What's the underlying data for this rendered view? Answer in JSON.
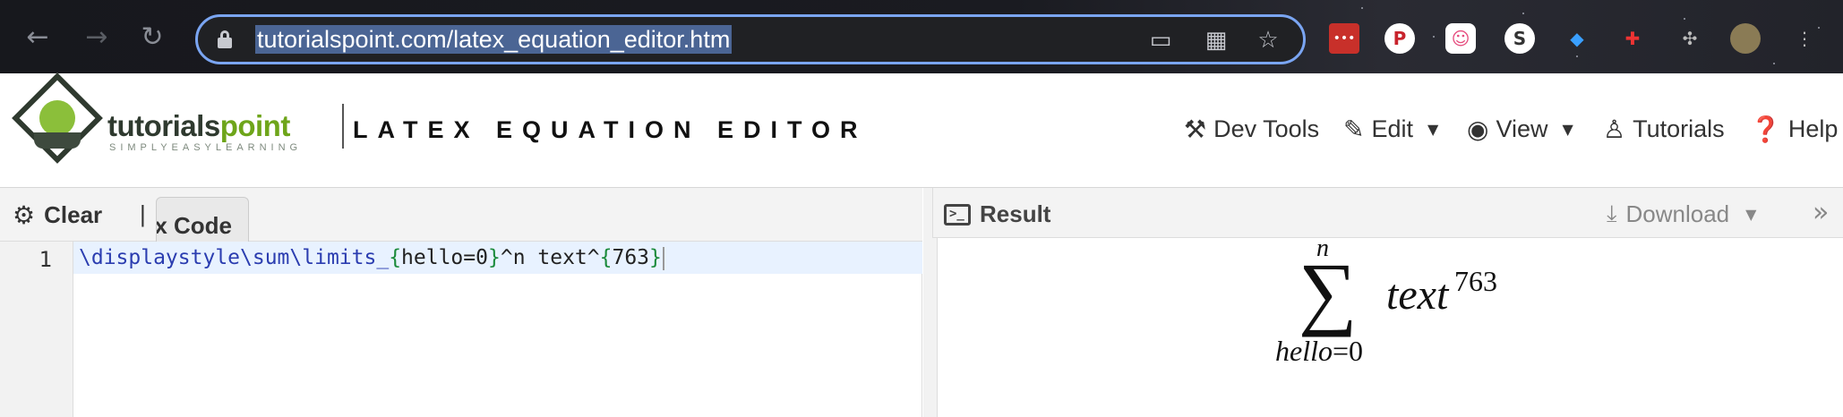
{
  "browser": {
    "url": "tutorialspoint.com/latex_equation_editor.htm",
    "nav": {
      "back_icon": "arrow-left-icon",
      "forward_icon": "arrow-right-icon",
      "reload_icon": "reload-icon"
    },
    "omnibox_icons": [
      "cast-icon",
      "qr-code-icon",
      "bookmark-star-icon"
    ],
    "extensions": [
      "lastpass-icon",
      "pinterest-icon",
      "ghost-icon",
      "s-icon",
      "diamond-icon",
      "medical-cross-icon",
      "puzzle-icon",
      "profile-avatar",
      "kebab-menu-icon"
    ],
    "colors": {
      "omnibox_border": "#7aa5f2",
      "url_highlight": "#4b6594"
    }
  },
  "site": {
    "logo_text_a": "tutorials",
    "logo_text_b": "point",
    "logo_tagline": "SIMPLYEASYLEARNING",
    "page_title": "LATEX EQUATION EDITOR",
    "menu": [
      {
        "label": "Dev Tools",
        "icon": "wrench-hammer-icon",
        "dropdown": false
      },
      {
        "label": "Edit",
        "icon": "edit-icon",
        "dropdown": true
      },
      {
        "label": "View",
        "icon": "eye-icon",
        "dropdown": true
      },
      {
        "label": "Tutorials",
        "icon": "tutorials-icon",
        "dropdown": false
      },
      {
        "label": "Help",
        "icon": "help-icon",
        "dropdown": false
      }
    ]
  },
  "editor": {
    "clear_label": "Clear",
    "pipe": "|",
    "tab_label": "x Code",
    "line_number": "1",
    "code": {
      "t1": "\\displaystyle\\sum\\limits_",
      "t2": "{",
      "t3": "hello=0",
      "t4": "}",
      "t5": "^n text^",
      "t6": "{",
      "t7": "763",
      "t8": "}"
    }
  },
  "result": {
    "title": "Result",
    "download_label": "Download",
    "equation": {
      "sum_symbol": "∑",
      "upper": "n",
      "lower_var": "hello",
      "lower_eq": "=0",
      "body": "text",
      "exponent": "763"
    }
  }
}
